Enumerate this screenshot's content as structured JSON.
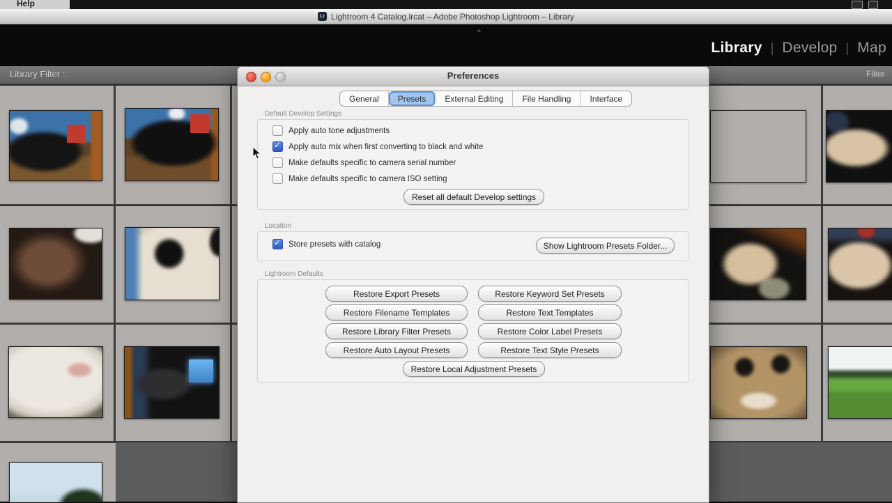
{
  "menubar": {
    "help_label": "Help",
    "status_icons": [
      "display-status-icon",
      "input-source-icon"
    ]
  },
  "window": {
    "title": "Lightroom 4 Catalog.lrcat – Adobe Photoshop Lightroom – Library",
    "doc_icon_label": "Lr"
  },
  "module_picker": {
    "items": [
      {
        "label": "Library",
        "active": true
      },
      {
        "label": "Develop",
        "active": false
      },
      {
        "label": "Map",
        "active": false
      }
    ]
  },
  "filter_bar": {
    "left_label": "Library Filter :",
    "right_label": "Filter"
  },
  "dialog": {
    "title": "Preferences",
    "traffic_lights": [
      "close-button",
      "minimize-button",
      "zoom-button"
    ],
    "tabs": [
      {
        "label": "General",
        "selected": false
      },
      {
        "label": "Presets",
        "selected": true
      },
      {
        "label": "External Editing",
        "selected": false
      },
      {
        "label": "File Handling",
        "selected": false
      },
      {
        "label": "Interface",
        "selected": false
      }
    ],
    "develop_section": {
      "label": "Default Develop Settings",
      "checkboxes": [
        {
          "label": "Apply auto tone adjustments",
          "checked": false
        },
        {
          "label": "Apply auto mix when first converting to black and white",
          "checked": true
        },
        {
          "label": "Make defaults specific to camera serial number",
          "checked": false
        },
        {
          "label": "Make defaults specific to camera ISO setting",
          "checked": false
        }
      ],
      "reset_button": "Reset all default Develop settings"
    },
    "location_section": {
      "label": "Location",
      "checkboxes": [
        {
          "label": "Store presets with catalog",
          "checked": true
        }
      ],
      "show_button": "Show Lightroom Presets Folder..."
    },
    "defaults_section": {
      "label": "Lightroom Defaults",
      "buttons": [
        "Restore Export Presets",
        "Restore Keyword Set Presets",
        "Restore Filename Templates",
        "Restore Text Templates",
        "Restore Library Filter Presets",
        "Restore Color Label Presets",
        "Restore Auto Layout Presets",
        "Restore Text Style Presets",
        "Restore Local Adjustment Presets"
      ]
    },
    "checkmark_glyph": "✓"
  },
  "colors": {
    "selected_tab_fill": "#a3c4ec",
    "selected_tab_border": "#5b92d8",
    "checkbox_checked": "#2f5cc0",
    "grid_cell_bg": "#b1aeab",
    "grid_dark_bg": "#5c5c5c",
    "panel_black": "#0a0a0a"
  }
}
